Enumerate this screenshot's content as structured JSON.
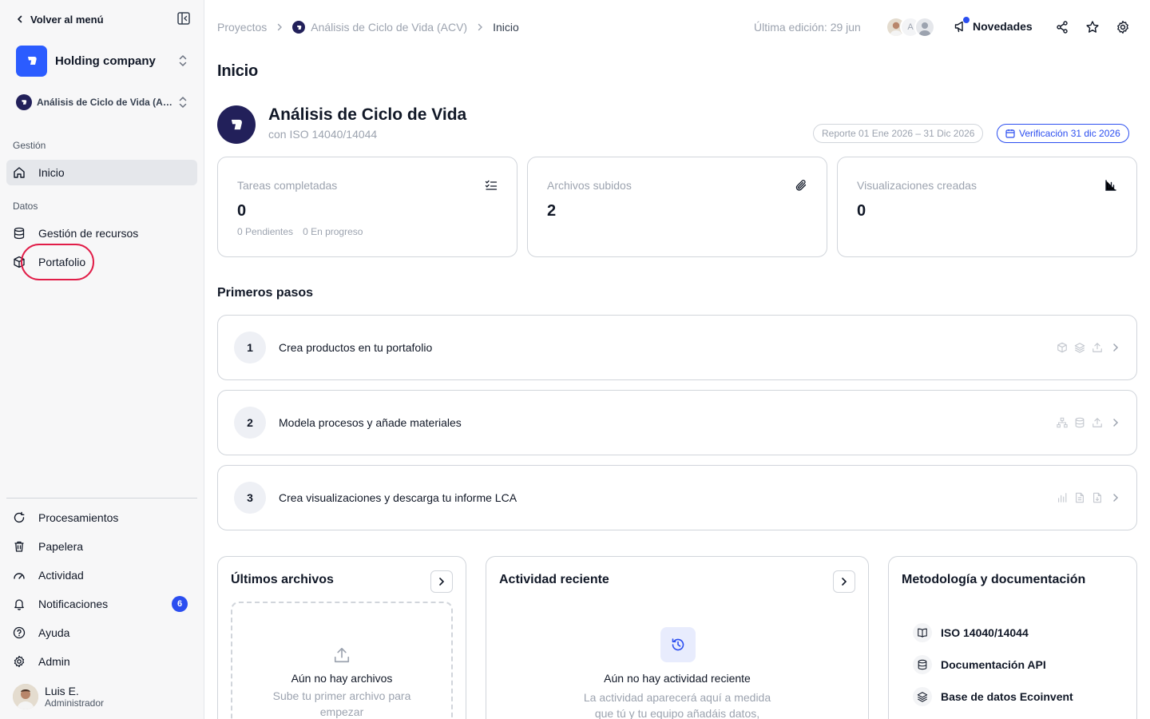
{
  "sidebar": {
    "back_label": "Volver al menú",
    "org_name": "Holding company",
    "project_name": "Análisis de Ciclo de Vida (ACV)",
    "sections": {
      "gestion": "Gestión",
      "datos": "Datos"
    },
    "items": [
      {
        "label": "Inicio",
        "icon": "home-icon",
        "active": true
      },
      {
        "label": "Gestión de recursos",
        "icon": "database-icon"
      },
      {
        "label": "Portafolio",
        "icon": "cube-icon"
      }
    ],
    "bottom_items": [
      {
        "label": "Procesamientos",
        "icon": "refresh-icon"
      },
      {
        "label": "Papelera",
        "icon": "trash-icon"
      },
      {
        "label": "Actividad",
        "icon": "gauge-icon"
      },
      {
        "label": "Notificaciones",
        "icon": "bell-icon",
        "badge": "6"
      },
      {
        "label": "Ayuda",
        "icon": "help-icon"
      },
      {
        "label": "Admin",
        "icon": "gear-icon"
      }
    ],
    "user": {
      "name": "Luis E.",
      "role": "Administrador"
    }
  },
  "topbar": {
    "breadcrumbs": [
      "Proyectos",
      "Análisis de Ciclo de Vida (ACV)",
      "Inicio"
    ],
    "last_edit": "Última edición: 29 jun",
    "avatar_initial": "A",
    "news_label": "Novedades"
  },
  "main": {
    "page_title": "Inicio",
    "project": {
      "title": "Análisis de Ciclo de Vida",
      "subtitle": "con ISO 14040/14044",
      "report_pill": "Reporte 01 Ene 2026 – 31 Dic 2026",
      "verification_pill": "Verificación 31 dic 2026"
    },
    "stats": [
      {
        "label": "Tareas completadas",
        "value": "0",
        "pending": "0 Pendientes",
        "in_progress": "0 En progreso",
        "icon": "checklist-icon"
      },
      {
        "label": "Archivos subidos",
        "value": "2",
        "icon": "paperclip-icon"
      },
      {
        "label": "Visualizaciones creadas",
        "value": "0",
        "icon": "bar-chart-icon"
      }
    ],
    "steps_title": "Primeros pasos",
    "steps": [
      {
        "num": "1",
        "text": "Crea productos en tu portafolio"
      },
      {
        "num": "2",
        "text": "Modela procesos y añade materiales"
      },
      {
        "num": "3",
        "text": "Crea visualizaciones y descarga tu informe LCA"
      }
    ],
    "files_panel": {
      "title": "Últimos archivos",
      "empty_title": "Aún no hay archivos",
      "empty_sub": "Sube tu primer archivo para empezar"
    },
    "activity_panel": {
      "title": "Actividad reciente",
      "empty_title": "Aún no hay actividad reciente",
      "empty_sub": "La actividad aparecerá aquí a medida que tú y tu equipo añadáis datos,"
    },
    "docs_panel": {
      "title": "Metodología y documentación",
      "items": [
        "ISO 14040/14044",
        "Documentación API",
        "Base de datos Ecoinvent"
      ]
    }
  },
  "colors": {
    "accent": "#2b4ef0",
    "brand_dark": "#22205a",
    "highlight": "#e11d48"
  }
}
